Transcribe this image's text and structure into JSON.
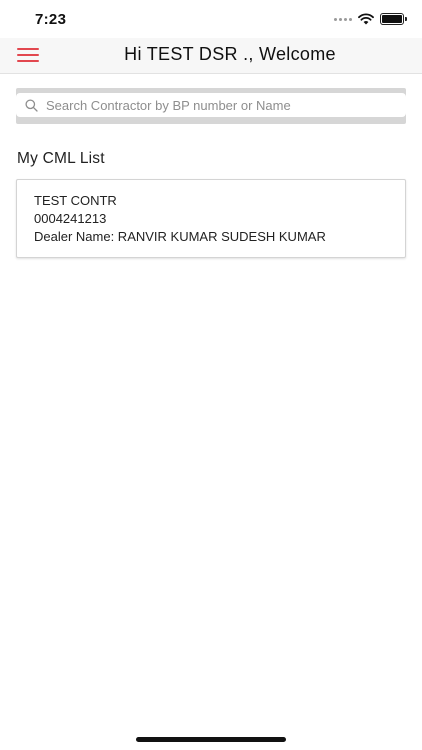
{
  "status_bar": {
    "time": "7:23"
  },
  "header": {
    "title": "Hi TEST DSR ., Welcome",
    "accent_color": "#e2474f"
  },
  "search": {
    "placeholder": "Search Contractor by BP number or Name",
    "value": ""
  },
  "list": {
    "title": "My CML List",
    "items": [
      {
        "name": "TEST CONTR",
        "bp_number": "0004241213",
        "dealer": "Dealer Name: RANVIR KUMAR SUDESH KUMAR"
      }
    ]
  },
  "icons": {
    "menu": "hamburger-icon",
    "search": "search-icon",
    "wifi": "wifi-icon",
    "battery": "battery-icon",
    "signal": "signal-icon"
  }
}
